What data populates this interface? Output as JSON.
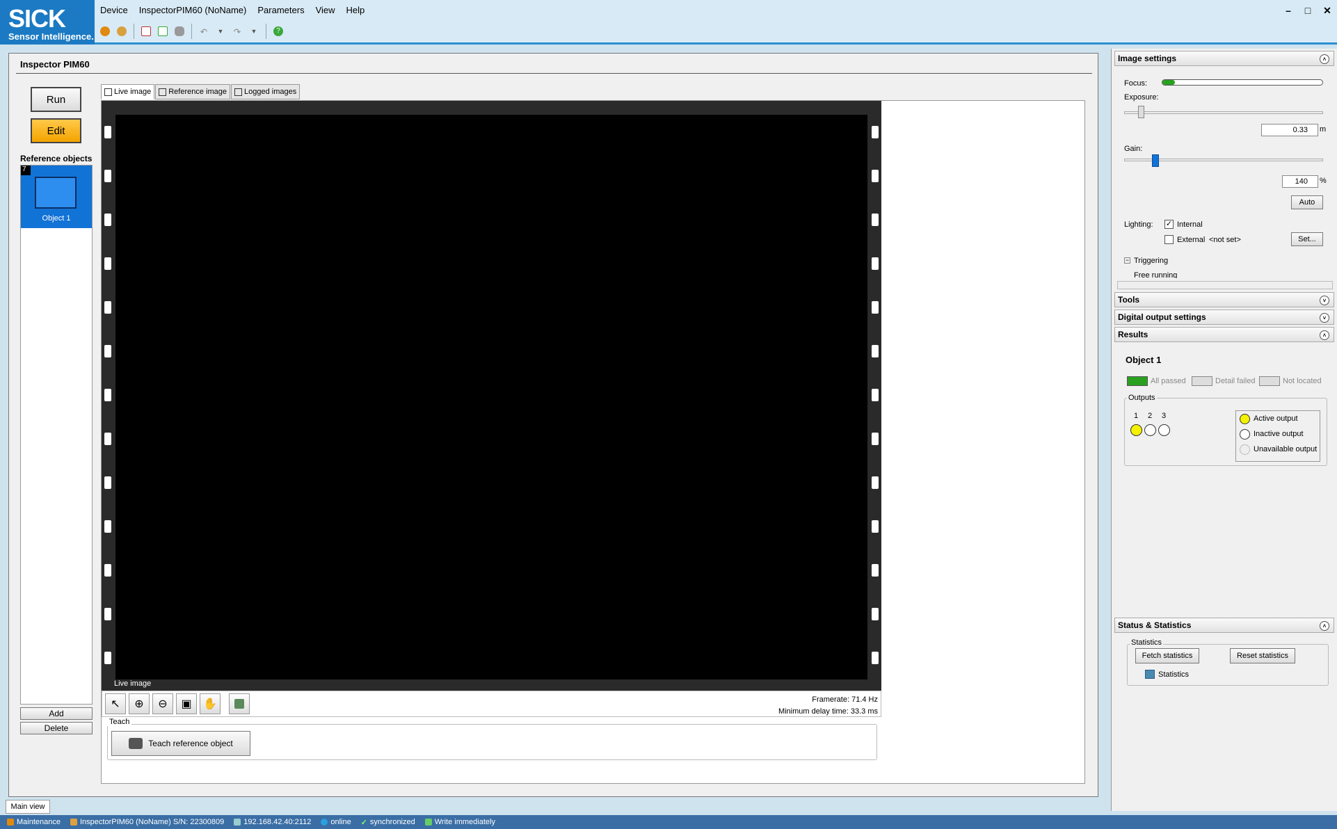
{
  "logo": {
    "brand": "SICK",
    "tagline": "Sensor Intelligence."
  },
  "menu": [
    "Device",
    "InspectorPIM60 (NoName)",
    "Parameters",
    "View",
    "Help"
  ],
  "toolbar": {
    "icons": [
      "connect-icon",
      "disconnect-icon",
      "open-icon",
      "save-icon",
      "cloud-icon",
      "undo-icon",
      "dropdown-icon",
      "redo-icon",
      "dropdown-icon",
      "help-icon"
    ]
  },
  "window": {
    "minimize": "–",
    "maximize": "□",
    "close": "✕"
  },
  "panel": {
    "title": "Inspector PIM60"
  },
  "buttons": {
    "run": "Run",
    "edit": "Edit",
    "add": "Add",
    "delete": "Delete"
  },
  "reference_objects": {
    "header": "Reference objects",
    "items": [
      {
        "num": "7",
        "label": "Object 1"
      }
    ]
  },
  "tabs": [
    "Live image",
    "Reference image",
    "Logged images"
  ],
  "image": {
    "live_label": "Live image",
    "framerate": "Framerate: 71.4 Hz",
    "min_delay": "Minimum delay time: 33.3 ms"
  },
  "teach": {
    "group": "Teach",
    "button": "Teach reference object"
  },
  "bottom": {
    "main_tab": "Main view"
  },
  "status": {
    "mode": "Maintenance",
    "device": "InspectorPIM60 (NoName) S/N: 22300809",
    "ip": "192.168.42.40:2112",
    "online": "online",
    "sync": "synchronized",
    "write": "Write immediately"
  },
  "image_settings": {
    "header": "Image settings",
    "focus_label": "Focus:",
    "focus_level": 0.08,
    "exposure_label": "Exposure:",
    "exposure_value": "0.33",
    "exposure_unit": "m",
    "gain_label": "Gain:",
    "gain_value": "140",
    "gain_unit": "%",
    "auto": "Auto",
    "lighting_label": "Lighting:",
    "internal": "Internal",
    "internal_checked": true,
    "external": "External",
    "external_value": "<not set>",
    "set": "Set...",
    "triggering": "Triggering",
    "free_running": "Free running"
  },
  "sections": {
    "tools": "Tools",
    "digital_output": "Digital output settings",
    "results": "Results",
    "status_stats": "Status & Statistics"
  },
  "results": {
    "object": "Object 1",
    "all_passed": "All passed",
    "detail_failed": "Detail failed",
    "not_located": "Not located",
    "outputs_label": "Outputs",
    "output_numbers": [
      "1",
      "2",
      "3"
    ],
    "active": "Active output",
    "inactive": "Inactive output",
    "unavailable": "Unavailable output"
  },
  "statistics": {
    "group": "Statistics",
    "fetch": "Fetch statistics",
    "reset": "Reset statistics",
    "item": "Statistics"
  },
  "colors": {
    "brand": "#1b7ac3",
    "edit": "#f3a400",
    "selected": "#1273d6",
    "status_bar": "#3a6ea5",
    "pass": "#2aa020",
    "active_output": "#f5f200"
  }
}
